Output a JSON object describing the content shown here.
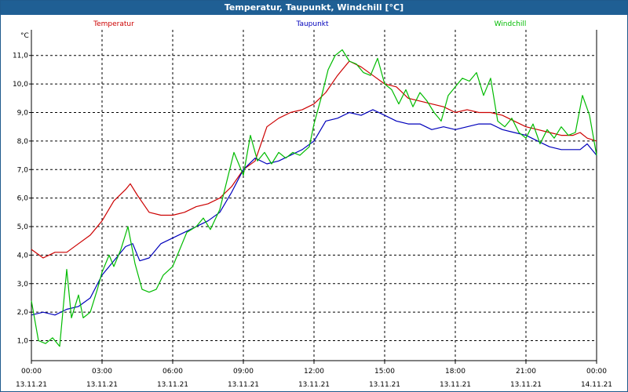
{
  "window": {
    "title": "Temperatur, Taupunkt, Windchill [°C]"
  },
  "chart_data": {
    "type": "line",
    "title": "Temperatur, Taupunkt, Windchill [°C]",
    "ylabel": "°C",
    "xlim": [
      0,
      24
    ],
    "ylim": [
      0.3,
      11.9
    ],
    "yticks": [
      1.0,
      2.0,
      3.0,
      4.0,
      5.0,
      6.0,
      7.0,
      8.0,
      9.0,
      10.0,
      11.0
    ],
    "ytick_labels": [
      "1,0",
      "2,0",
      "3,0",
      "4,0",
      "5,0",
      "6,0",
      "7,0",
      "8,0",
      "9,0",
      "10,0",
      "11,0"
    ],
    "xticks": [
      0,
      3,
      6,
      9,
      12,
      15,
      18,
      21,
      24
    ],
    "xtick_labels": [
      {
        "time": "00:00",
        "date": "13.11.21"
      },
      {
        "time": "03:00",
        "date": "13.11.21"
      },
      {
        "time": "06:00",
        "date": "13.11.21"
      },
      {
        "time": "09:00",
        "date": "13.11.21"
      },
      {
        "time": "12:00",
        "date": "13.11.21"
      },
      {
        "time": "15:00",
        "date": "13.11.21"
      },
      {
        "time": "18:00",
        "date": "13.11.21"
      },
      {
        "time": "21:00",
        "date": "13.11.21"
      },
      {
        "time": "00:00",
        "date": "14.11.21"
      }
    ],
    "grid": true,
    "legend_position": "top",
    "series": [
      {
        "name": "Temperatur",
        "color": "#cc0000",
        "x": [
          0,
          0.5,
          1,
          1.5,
          2,
          2.5,
          3,
          3.5,
          4,
          4.2,
          4.5,
          5,
          5.5,
          6,
          6.5,
          7,
          7.5,
          8,
          8.5,
          9,
          9.5,
          10,
          10.5,
          11,
          11.5,
          12,
          12.5,
          13,
          13.2,
          13.5,
          14,
          14.5,
          15,
          15.5,
          16,
          16.5,
          17,
          17.5,
          18,
          18.5,
          19,
          19.5,
          20,
          20.5,
          21,
          21.5,
          22,
          22.5,
          23,
          23.3,
          23.6,
          24
        ],
        "y": [
          4.2,
          3.9,
          4.1,
          4.1,
          4.4,
          4.7,
          5.2,
          5.9,
          6.3,
          6.5,
          6.1,
          5.5,
          5.4,
          5.4,
          5.5,
          5.7,
          5.8,
          6.0,
          6.4,
          7.0,
          7.3,
          8.5,
          8.8,
          9.0,
          9.1,
          9.3,
          9.7,
          10.3,
          10.5,
          10.8,
          10.6,
          10.3,
          10.0,
          9.9,
          9.5,
          9.4,
          9.3,
          9.2,
          9.0,
          9.1,
          9.0,
          9.0,
          8.9,
          8.7,
          8.5,
          8.4,
          8.3,
          8.2,
          8.2,
          8.3,
          8.1,
          8.0
        ]
      },
      {
        "name": "Taupunkt",
        "color": "#0000bb",
        "x": [
          0,
          0.5,
          1,
          1.5,
          2,
          2.5,
          3,
          3.5,
          4,
          4.3,
          4.6,
          5,
          5.5,
          6,
          6.5,
          7,
          7.5,
          8,
          8.5,
          9,
          9.5,
          10,
          10.5,
          11,
          11.5,
          12,
          12.5,
          13,
          13.5,
          14,
          14.5,
          15,
          15.5,
          16,
          16.5,
          17,
          17.5,
          18,
          18.5,
          19,
          19.5,
          20,
          20.5,
          21,
          21.5,
          22,
          22.5,
          23,
          23.3,
          23.6,
          24
        ],
        "y": [
          1.9,
          2.0,
          1.9,
          2.1,
          2.2,
          2.5,
          3.3,
          3.8,
          4.3,
          4.4,
          3.8,
          3.9,
          4.4,
          4.6,
          4.8,
          5.0,
          5.2,
          5.5,
          6.2,
          7.0,
          7.4,
          7.2,
          7.3,
          7.5,
          7.7,
          8.0,
          8.7,
          8.8,
          9.0,
          8.9,
          9.1,
          8.9,
          8.7,
          8.6,
          8.6,
          8.4,
          8.5,
          8.4,
          8.5,
          8.6,
          8.6,
          8.4,
          8.3,
          8.2,
          8.0,
          7.8,
          7.7,
          7.7,
          7.7,
          7.9,
          7.5
        ]
      },
      {
        "name": "Windchill",
        "color": "#00bb00",
        "x": [
          0,
          0.3,
          0.6,
          0.9,
          1.2,
          1.5,
          1.7,
          2.0,
          2.2,
          2.5,
          2.8,
          3.0,
          3.3,
          3.5,
          3.8,
          4.1,
          4.4,
          4.7,
          5.0,
          5.3,
          5.6,
          6.0,
          6.3,
          6.6,
          7.0,
          7.3,
          7.6,
          8.0,
          8.3,
          8.6,
          9.0,
          9.3,
          9.6,
          9.9,
          10.2,
          10.5,
          10.8,
          11.1,
          11.4,
          11.8,
          12.0,
          12.3,
          12.6,
          12.9,
          13.2,
          13.5,
          13.8,
          14.1,
          14.4,
          14.7,
          15.0,
          15.3,
          15.6,
          15.9,
          16.2,
          16.5,
          16.8,
          17.1,
          17.4,
          17.7,
          18.0,
          18.3,
          18.6,
          18.9,
          19.2,
          19.5,
          19.8,
          20.1,
          20.4,
          20.7,
          21.0,
          21.3,
          21.6,
          21.9,
          22.2,
          22.5,
          22.8,
          23.1,
          23.4,
          23.7,
          24.0
        ],
        "y": [
          2.4,
          1.0,
          0.9,
          1.1,
          0.8,
          3.5,
          1.8,
          2.6,
          1.8,
          2.0,
          2.8,
          3.4,
          4.0,
          3.6,
          4.2,
          5.0,
          3.7,
          2.8,
          2.7,
          2.8,
          3.3,
          3.6,
          4.2,
          4.8,
          5.0,
          5.3,
          4.9,
          5.6,
          6.6,
          7.6,
          6.8,
          8.2,
          7.3,
          7.6,
          7.2,
          7.6,
          7.4,
          7.6,
          7.5,
          7.8,
          8.6,
          9.5,
          10.5,
          11.0,
          11.2,
          10.8,
          10.7,
          10.4,
          10.3,
          10.9,
          10.0,
          9.8,
          9.3,
          9.8,
          9.2,
          9.7,
          9.4,
          9.0,
          8.7,
          9.6,
          9.9,
          10.2,
          10.1,
          10.4,
          9.6,
          10.2,
          8.7,
          8.5,
          8.8,
          8.3,
          8.1,
          8.6,
          7.9,
          8.4,
          8.1,
          8.5,
          8.2,
          8.3,
          9.6,
          8.9,
          7.5
        ]
      }
    ]
  }
}
